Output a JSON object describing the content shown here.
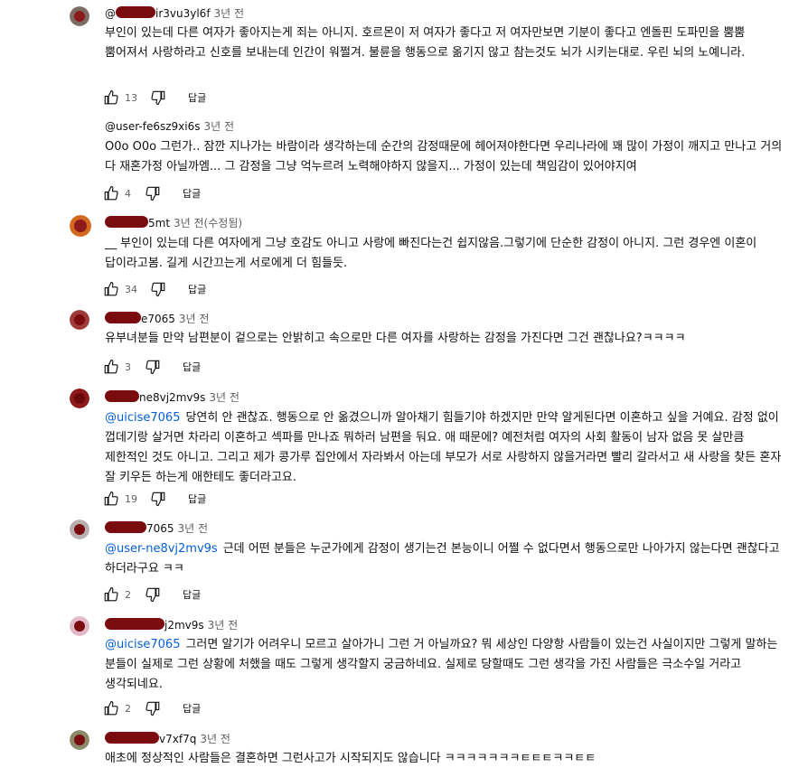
{
  "comments": [
    {
      "author_visible": "ir3vu3yl6f",
      "time": "3년 전",
      "text": "부인이 있는데 다른 여자가 좋아지는게 죄는 아니지. 호르몬이 저 여자가 좋다고 저 여자만보면 기분이 좋다고 엔돌핀 도파민을 뿜뿜 뿜어져서 사랑하라고 신호를 보내는데 인간이 워쩔겨. 불륜을 행동으로 옮기지 않고 참는것도 뇌가 시키는대로. 우린 뇌의 노예니라.",
      "likes": "13",
      "reply_label": "답글"
    },
    {
      "author_visible": "@user-fe6sz9xi6s",
      "time": "3년 전",
      "text": "O0o O0o 그런가.. 잠깐 지나가는 바람이라 생각하는데 순간의 감정때문에 헤어져야한다면 우리나라에 꽤 많이 가정이 깨지고 만나고 거의 다 재혼가정 아닐까엠... 그 감정을 그냥 억누르려 노력해야하지 않을지... 가정이 있는데 책임감이 있어야지여",
      "likes": "4",
      "reply_label": "답글"
    },
    {
      "author_visible": "5mt",
      "time": "3년 전(수정됨)",
      "text": "__ 부인이 있는데 다른 여자에게 그냥 호감도 아니고 사랑에 빠진다는건 쉽지않음.그렇기에 단순한 감정이 아니지. 그런 경우엔 이혼이 답이라고봄. 길게 시간끄는게 서로에게 더 힘들듯.",
      "likes": "34",
      "reply_label": "답글"
    },
    {
      "author_visible": "e7065",
      "time": "3년 전",
      "text": "유부녀분들 만약 남편분이 겉으로는 안밝히고 속으로만 다른 여자를 사랑하는 감정을 가진다면 그건 괜찮나요?ㅋㅋㅋㅋ",
      "likes": "3",
      "reply_label": "답글"
    },
    {
      "author_visible": "ne8vj2mv9s",
      "time": "3년 전",
      "mention": "@uicise7065",
      "text": "당연히 안 괜찮죠. 행동으로 안 옮겼으니까 알아채기 힘들기야 하겠지만 만약 알게된다면 이혼하고 싶을 거예요. 감정 없이 껍데기랑 살거면 차라리 이혼하고 섹파를 만나죠 뭐하러 남편을 둬요. 애 때문에? 예전처럼 여자의 사회 활동이 남자 없음 못 살만큼 제한적인 것도 아니고. 그리고 제가 콩가루 집안에서 자라봐서 아는데 부모가 서로 사랑하지 않을거라면 빨리 갈라서고 새 사랑을 찾든 혼자 잘 키우든 하는게 애한테도 좋더라고요.",
      "likes": "19",
      "reply_label": "답글"
    },
    {
      "author_visible": "7065",
      "time": "3년 전",
      "mention": "@user-ne8vj2mv9s",
      "text": "근데 어떤 분들은 누군가에게 감정이 생기는건 본능이니 어쩔 수 없다면서 행동으로만 나아가지 않는다면 괜찮다고 하더라구요 ㅋㅋ",
      "likes": "2",
      "reply_label": "답글"
    },
    {
      "author_visible": "j2mv9s",
      "time": "3년 전",
      "mention": "@uicise7065",
      "text": "그러면 알기가 어려우니 모르고 살아가니 그런 거 아닐까요? 뭐 세상인 다양항 사람들이 있는건 사실이지만 그렇게 말하는 분들이 실제로 그런 상황에 처했을 때도 그렇게 생각할지 궁금하네요. 실제로 당할때도 그런 생각을 가진 사람들은 극소수일 거라고 생각되네요.",
      "likes": "2",
      "reply_label": "답글"
    },
    {
      "author_visible": "v7xf7q",
      "time": "3년 전",
      "text": "애초에 정상적인 사람들은 결혼하면 그런사고가 시작되지도 않습니다 ㅋㅋㅋㅋㅋㅋㅋㅌㅌㅌㅋㅋㅌㅌ"
    }
  ],
  "colors": {
    "link": "#065fd4",
    "secondary_text": "#606060",
    "redaction": "#7a0b0f"
  }
}
